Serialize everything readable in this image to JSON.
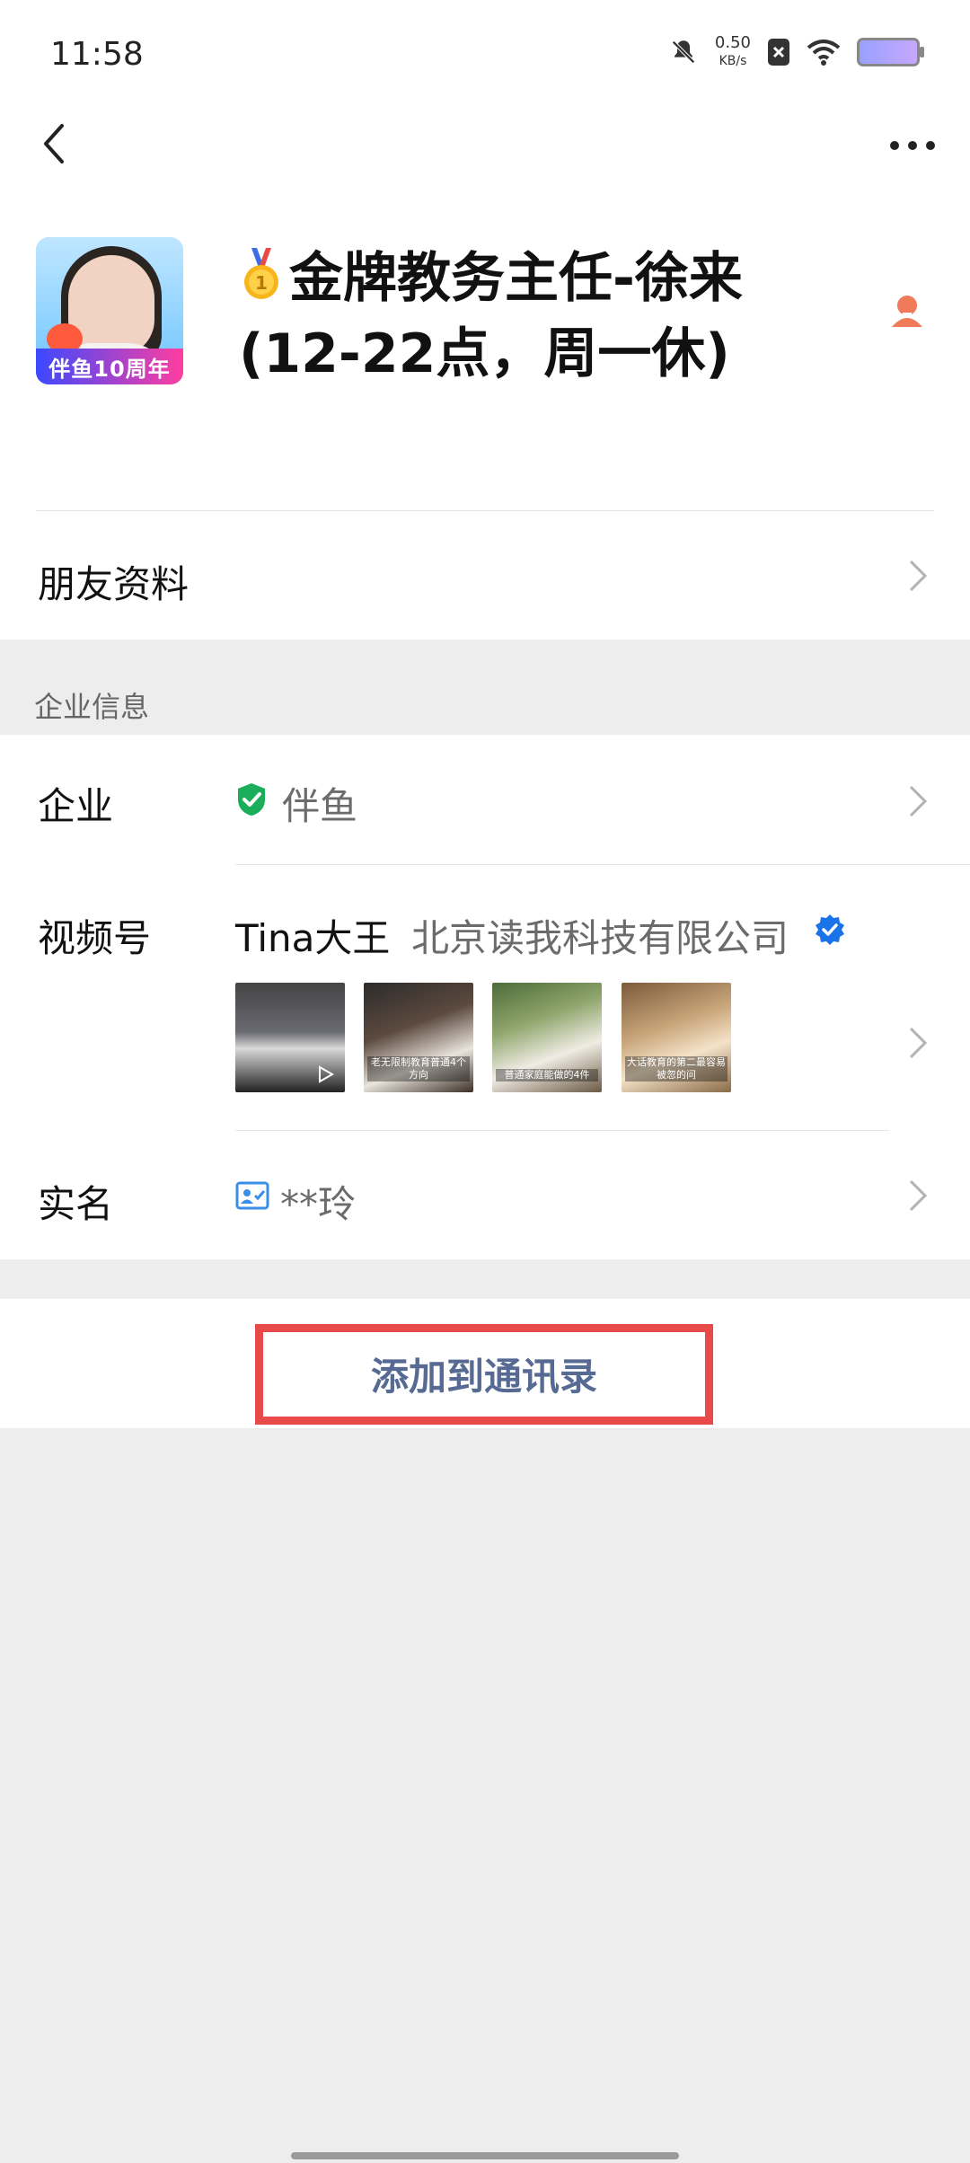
{
  "status": {
    "time": "11:58",
    "net_speed_value": "0.50",
    "net_speed_unit": "KB/s"
  },
  "profile": {
    "name": "金牌教务主任-徐来",
    "subtitle": "(12-22点，周一休)",
    "avatar_badge": "伴鱼10周年"
  },
  "friend_info_label": "朋友资料",
  "section_title": "企业信息",
  "company": {
    "label": "企业",
    "value": "伴鱼"
  },
  "channels": {
    "label": "视频号",
    "account": "Tina大王",
    "org": "北京读我科技有限公司",
    "thumbnails": [
      {
        "caption": ""
      },
      {
        "caption": "老无限制教育普通4个方向"
      },
      {
        "caption": "普通家庭能做的4件"
      },
      {
        "caption": "大话教育的第二最容易被忽的问"
      }
    ]
  },
  "realname": {
    "label": "实名",
    "value": "**玲"
  },
  "add_button": "添加到通讯录",
  "colors": {
    "accent_text": "#566a93",
    "highlight_border": "#e84a4a",
    "verified_green": "#1aad5a",
    "verified_blue": "#1a73e8"
  }
}
